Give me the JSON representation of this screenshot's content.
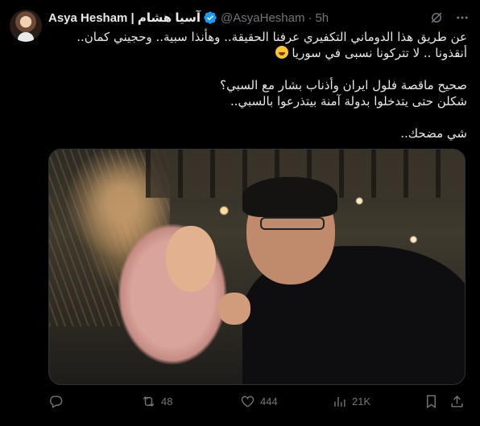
{
  "user": {
    "display_name": "Asya Hesham | آسيا هشام",
    "handle": "@AsyaHesham",
    "separator": "·",
    "time": "5h",
    "verified": true
  },
  "tweet": {
    "lines": [
      "عن طريق هذا الدوماني التكفيري عرفنا الحقيقة.. وهأنذا سبية.. وحجيني كمان..",
      "أنقذونا .. لا تتركونا نسبى في سوريا",
      "",
      "صحيح ماقصة فلول ايران وأذناب بشار مع السبي؟",
      "شكلن حتى يتدخلوا بدولة آمنة بيتذرعوا بالسبي..",
      "",
      "شي مضحك.."
    ],
    "emoji": "face-with-tears-of-joy"
  },
  "actions": {
    "reply_count": "",
    "retweet_count": "48",
    "like_count": "444",
    "views_count": "21K"
  },
  "colors": {
    "background": "#000000",
    "text": "#e7e9ea",
    "muted": "#71767b",
    "verified": "#1d9bf0"
  }
}
